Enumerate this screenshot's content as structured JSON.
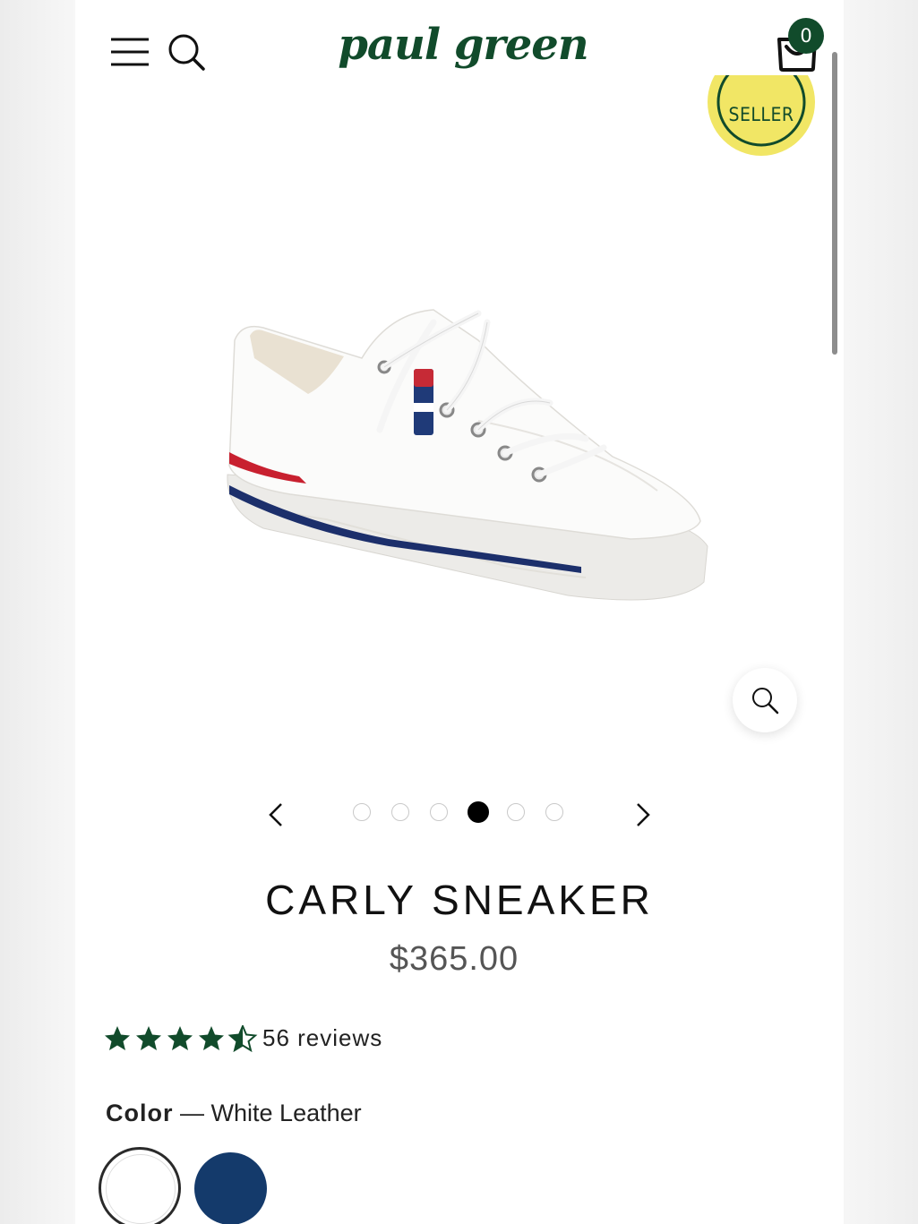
{
  "header": {
    "logo_text": "paul green",
    "cart_count": "0"
  },
  "badge": {
    "text": "SELLER"
  },
  "product": {
    "title": "CARLY SNEAKER",
    "price": "$365.00",
    "image_alt": "white leather low-top sneaker with red and navy stripes"
  },
  "carousel": {
    "total": 6,
    "active_index": 3
  },
  "reviews": {
    "rating": 4.5,
    "max": 5,
    "count_label": "56 reviews"
  },
  "color": {
    "label": "Color",
    "separator": "—",
    "selected": "White Leather",
    "options": [
      {
        "name": "White Leather",
        "hex": "#ffffff",
        "selected": true
      },
      {
        "name": "Navy",
        "hex": "#143a6b",
        "selected": false
      }
    ]
  },
  "colors": {
    "brand_green": "#114b2b",
    "badge_yellow": "#f1e665",
    "text_dark": "#111111",
    "price_grey": "#555555"
  }
}
